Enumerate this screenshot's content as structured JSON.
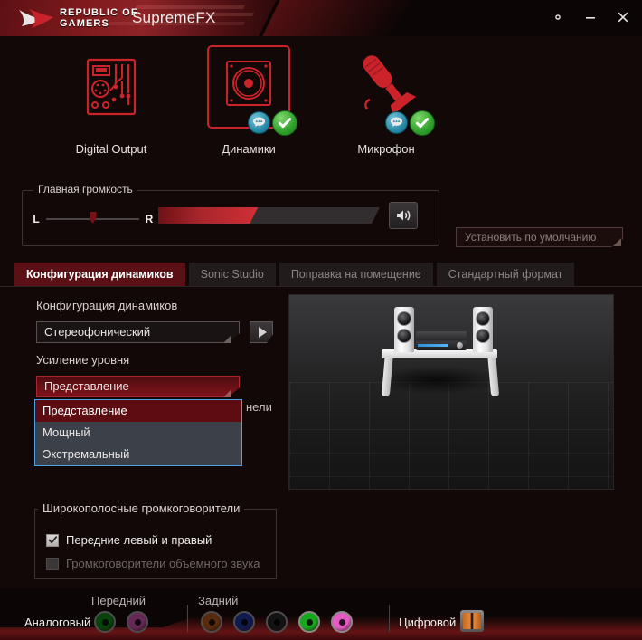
{
  "window": {
    "brand_line1": "REPUBLIC OF",
    "brand_line2": "GAMERS",
    "title": "SupremeFX",
    "settings_icon": "gear-icon",
    "minimize_icon": "minimize-icon",
    "close_icon": "close-icon"
  },
  "devices": [
    {
      "label": "Digital Output",
      "icon": "circuit-board-icon",
      "selected": false,
      "has_chat_badge": false,
      "has_check_badge": false
    },
    {
      "label": "Динамики",
      "icon": "speaker-icon",
      "selected": true,
      "has_chat_badge": true,
      "has_check_badge": true
    },
    {
      "label": "Микрофон",
      "icon": "microphone-icon",
      "selected": false,
      "has_chat_badge": true,
      "has_check_badge": true
    }
  ],
  "master_volume": {
    "group_title": "Главная громкость",
    "balance_left_label": "L",
    "balance_right_label": "R",
    "balance_value": 50,
    "volume_percent": 45,
    "speaker_icon": "speaker-wave-icon"
  },
  "default_button": {
    "label": "Установить по умолчанию",
    "enabled": false
  },
  "tabs": [
    {
      "label": "Конфигурация динамиков",
      "active": true
    },
    {
      "label": "Sonic Studio",
      "active": false
    },
    {
      "label": "Поправка на помещение",
      "active": false
    },
    {
      "label": "Стандартный формат",
      "active": false
    }
  ],
  "speaker_config": {
    "label": "Конфигурация динамиков",
    "value": "Стереофонический",
    "play_icon": "play-icon"
  },
  "level_gain": {
    "label": "Усиление уровня",
    "value": "Представление",
    "open": true,
    "options": [
      {
        "label": "Представление",
        "selected": true
      },
      {
        "label": "Мощный",
        "selected": false
      },
      {
        "label": "Экстремальный",
        "selected": false
      }
    ]
  },
  "occluded_text": "нели",
  "full_range": {
    "group_title": "Широкополосные громкоговорители",
    "items": [
      {
        "label": "Передние левый и правый",
        "checked": true,
        "disabled": false
      },
      {
        "label": "Громкоговорители объемного звука",
        "checked": false,
        "disabled": true
      }
    ]
  },
  "bottom_bar": {
    "analog_label": "Аналоговый",
    "front_label": "Передний",
    "rear_label": "Задний",
    "digital_label": "Цифровой",
    "front_jacks": [
      {
        "name": "line-out-green-jack",
        "color": "#0d5c12",
        "active": false
      },
      {
        "name": "mic-in-pink-jack",
        "color": "#8d3878",
        "active": false
      }
    ],
    "rear_jacks": [
      {
        "name": "center-sub-orange-jack",
        "color": "#7a3c12",
        "active": false
      },
      {
        "name": "rear-blue-jack",
        "color": "#16256e",
        "active": false
      },
      {
        "name": "side-black-jack",
        "color": "#1c1a1b",
        "active": false
      },
      {
        "name": "line-out-green-jack",
        "color": "#18a81b",
        "active": true
      },
      {
        "name": "mic-in-pink-jack",
        "color": "#e25bc0",
        "active": true
      }
    ],
    "digital_port": {
      "name": "spdif-port-icon",
      "color": "#d4781f"
    }
  },
  "colors": {
    "accent_red": "#a8262c",
    "brand_red": "#c8222a",
    "background": "#110807",
    "highlight_blue": "#4da3e8",
    "check_green": "#2f9e2b"
  }
}
